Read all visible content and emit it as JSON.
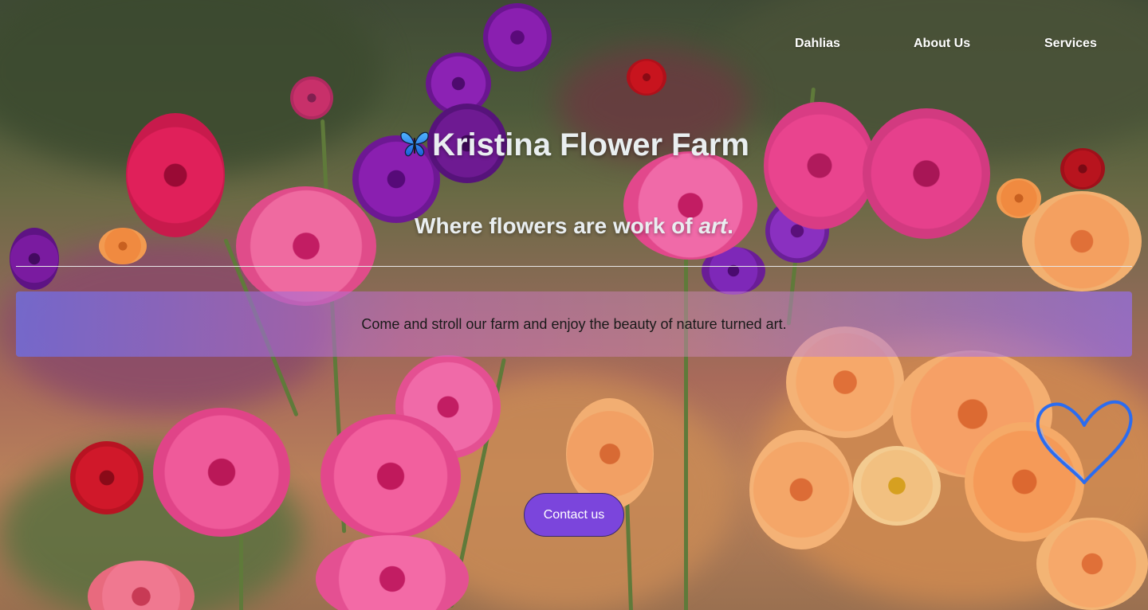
{
  "nav": {
    "items": [
      {
        "label": "Dahlias"
      },
      {
        "label": "About Us"
      },
      {
        "label": "Services"
      }
    ]
  },
  "hero": {
    "title_icon": "butterfly-icon",
    "title": "Kristina Flower Farm",
    "subtitle_prefix": "Where flowers are work of ",
    "subtitle_emph": "art",
    "subtitle_suffix": "."
  },
  "banner": {
    "text": "Come and stroll our farm and enjoy the beauty of nature turned art."
  },
  "cta": {
    "label": "Contact us"
  },
  "decorations": {
    "heart_icon": "heart-icon"
  },
  "colors": {
    "button_bg": "#7b45dc",
    "heart_stroke": "#2b6cf0",
    "text_light": "#e9eef0"
  }
}
